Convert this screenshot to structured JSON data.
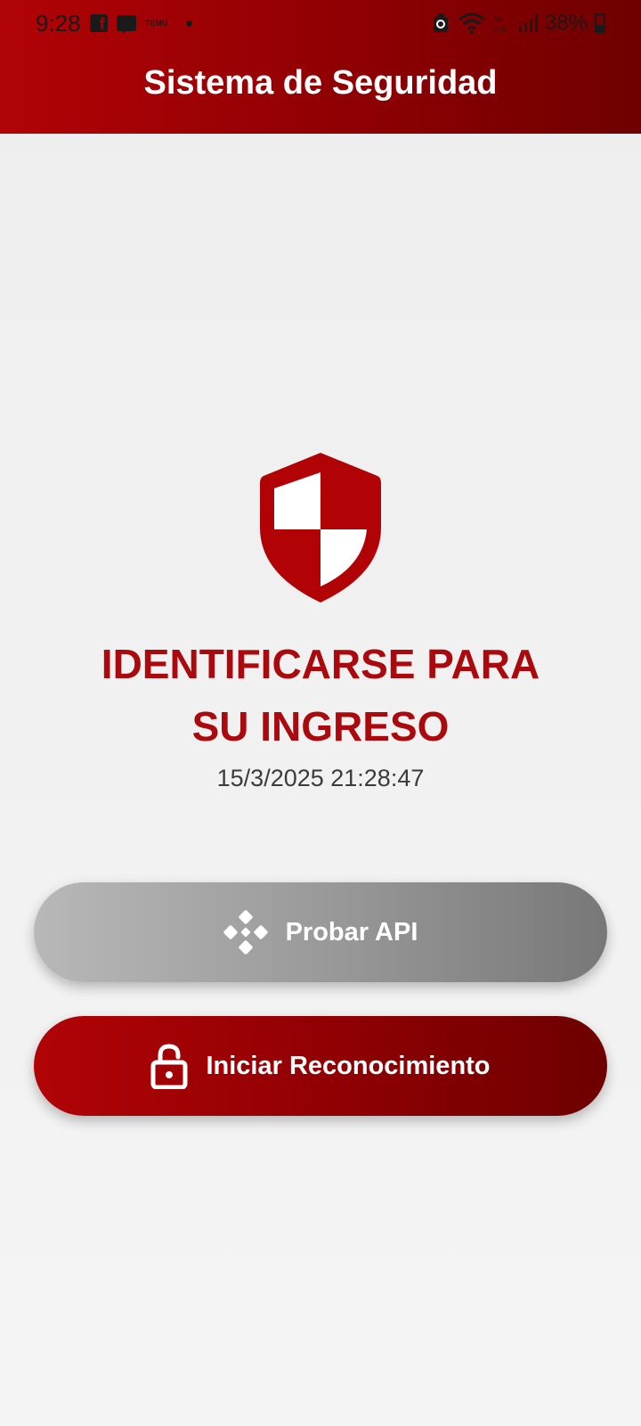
{
  "status_bar": {
    "time": "9:28",
    "notification_icons": [
      "facebook-icon",
      "message-icon",
      "temu-icon"
    ],
    "temu_label": "TEMU",
    "battery": "38%"
  },
  "header": {
    "title": "Sistema de Seguridad"
  },
  "main": {
    "icon": "shield-icon",
    "headline_line1": "IDENTIFICARSE PARA",
    "headline_line2": "SU INGRESO",
    "datetime": "15/3/2025 21:28:47"
  },
  "actions": {
    "test_api": {
      "label": "Probar API",
      "icon": "api-icon"
    },
    "start_recognition": {
      "label": "Iniciar Reconocimiento",
      "icon": "lock-open-icon"
    }
  },
  "colors": {
    "primary_red": "#aa0a0d",
    "header_red_start": "#b10306",
    "header_red_end": "#6f0000",
    "gray_button_start": "#b8b8b8",
    "gray_button_end": "#787878"
  }
}
